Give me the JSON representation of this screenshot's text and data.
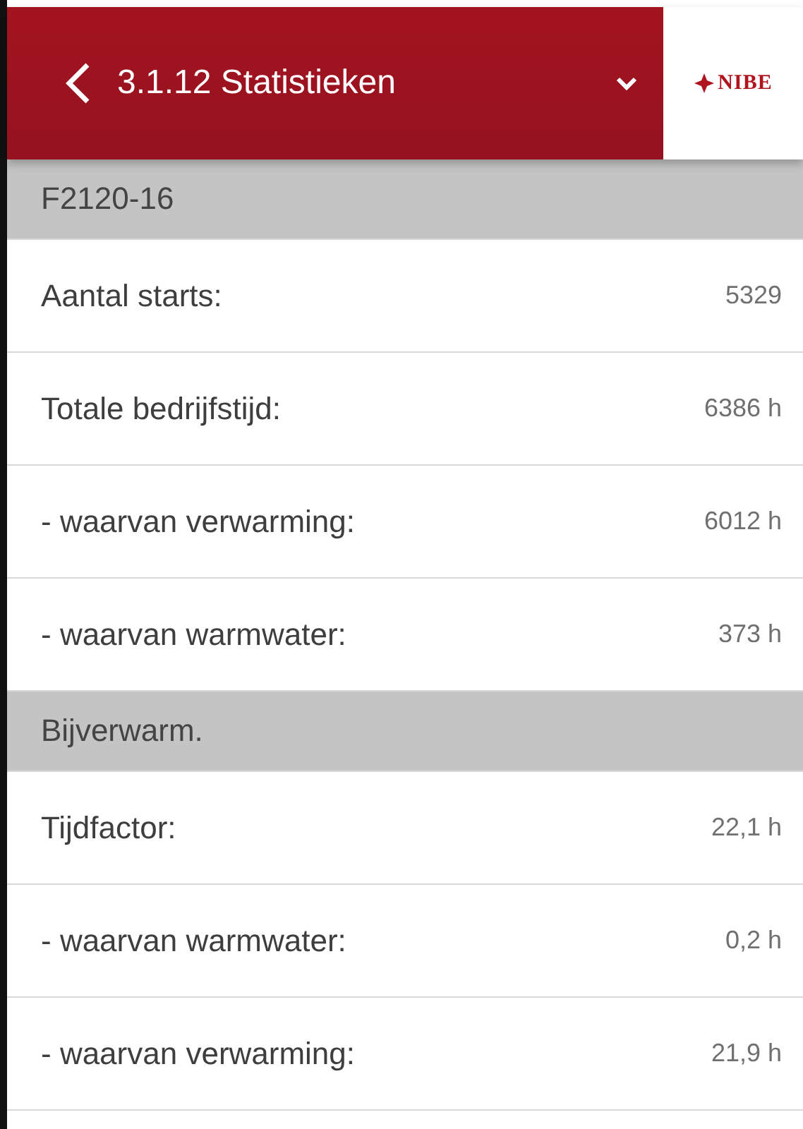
{
  "header": {
    "title": "3.1.12 Statistieken",
    "logo": "NIBE"
  },
  "sections": [
    {
      "title": "F2120-16",
      "rows": [
        {
          "label": "Aantal starts:",
          "value": "5329"
        },
        {
          "label": "Totale bedrijfstijd:",
          "value": "6386 h"
        },
        {
          "label": "- waarvan verwarming:",
          "value": "6012 h"
        },
        {
          "label": "- waarvan warmwater:",
          "value": "373 h"
        }
      ]
    },
    {
      "title": "Bijverwarm.",
      "rows": [
        {
          "label": "Tijdfactor:",
          "value": "22,1 h"
        },
        {
          "label": "- waarvan warmwater:",
          "value": "0,2 h"
        },
        {
          "label": "- waarvan verwarming:",
          "value": "21,9 h"
        }
      ]
    }
  ]
}
